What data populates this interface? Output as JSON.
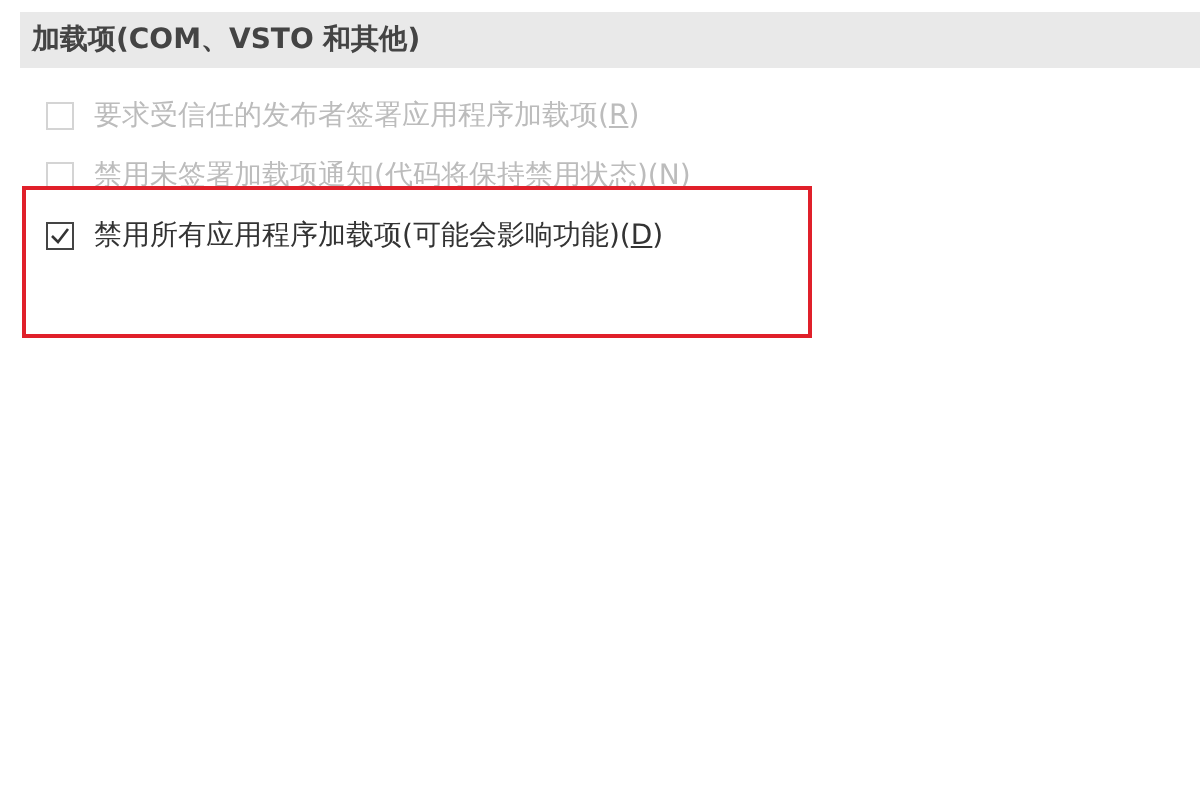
{
  "section": {
    "title": "加载项(COM、VSTO 和其他)"
  },
  "options": [
    {
      "label_start": "要求受信任的发布者签署应用程序加载项(",
      "access_key": "R",
      "label_end": ")",
      "checked": false,
      "disabled": true
    },
    {
      "label_start": "禁用未签署加载项通知(代码将保持禁用状态)(",
      "access_key": "N",
      "label_end": ")",
      "checked": false,
      "disabled": true
    },
    {
      "label_start": "禁用所有应用程序加载项(可能会影响功能)(",
      "access_key": "D",
      "label_end": ")",
      "checked": true,
      "disabled": false
    }
  ],
  "highlight": {
    "color": "#e0202a"
  }
}
